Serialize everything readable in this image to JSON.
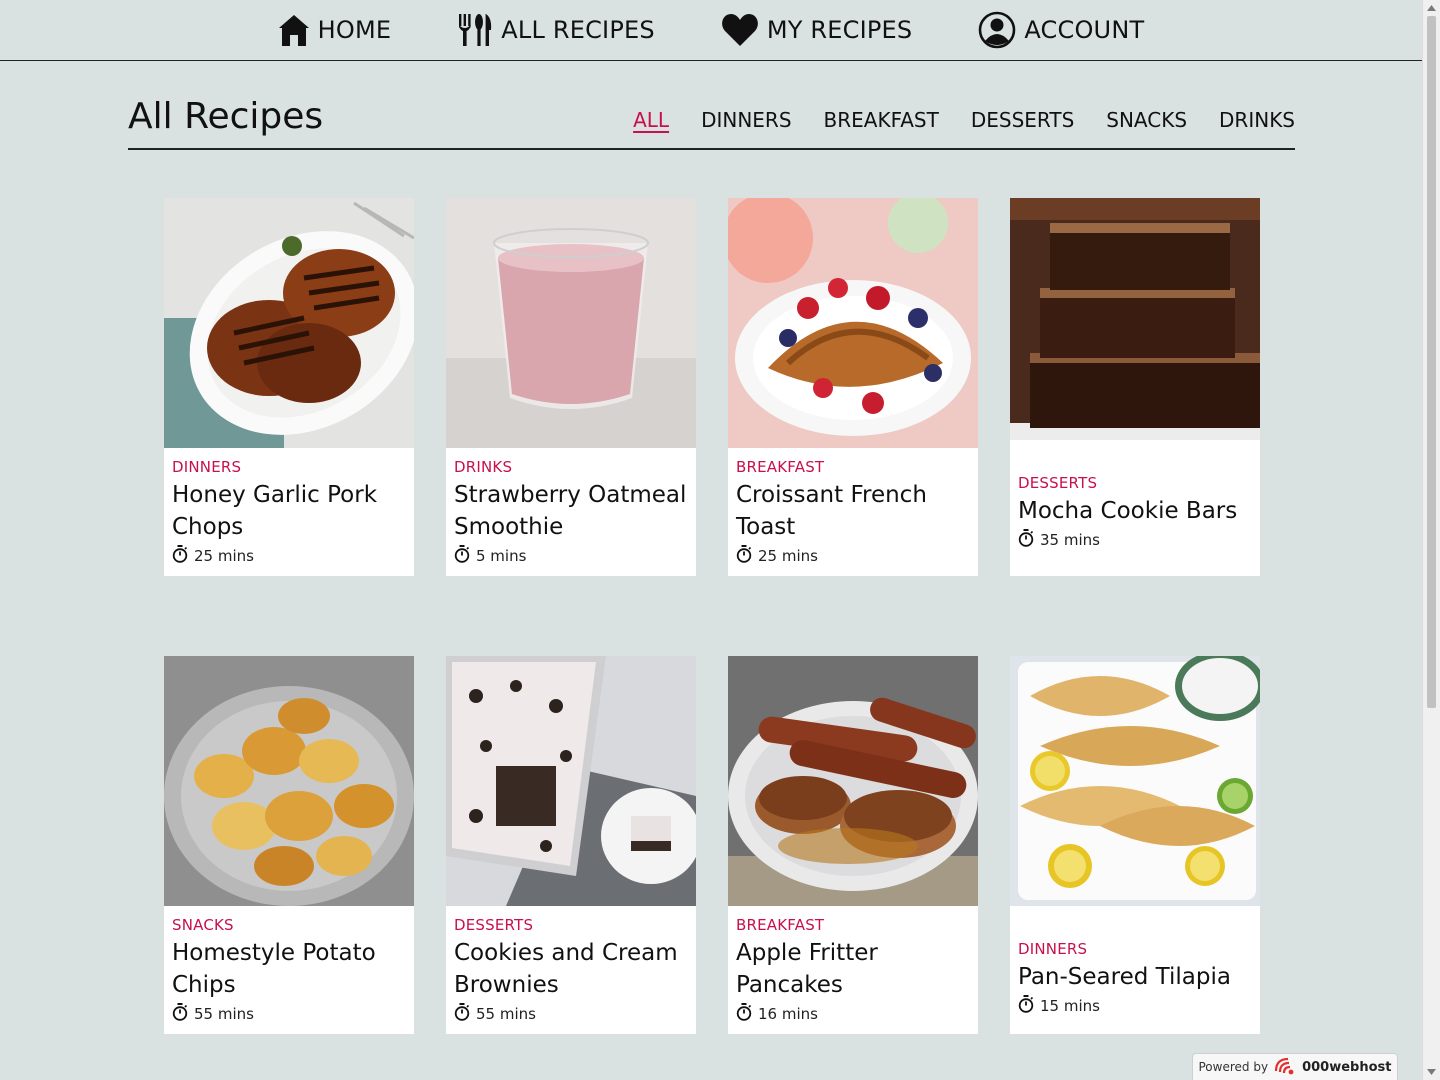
{
  "nav": {
    "items": [
      {
        "label": "HOME",
        "icon": "home-icon"
      },
      {
        "label": "ALL RECIPES",
        "icon": "utensils-icon"
      },
      {
        "label": "MY RECIPES",
        "icon": "heart-icon"
      },
      {
        "label": "ACCOUNT",
        "icon": "user-circle-icon"
      }
    ]
  },
  "page": {
    "title": "All Recipes",
    "filters": [
      "ALL",
      "DINNERS",
      "BREAKFAST",
      "DESSERTS",
      "SNACKS",
      "DRINKS"
    ],
    "active_filter": "ALL"
  },
  "recipes": [
    {
      "category": "DINNERS",
      "title": "Honey Garlic Pork Chops",
      "time": "25 mins",
      "image": "grilled-pork-chops-photo"
    },
    {
      "category": "DRINKS",
      "title": "Strawberry Oatmeal Smoothie",
      "time": "5 mins",
      "image": "pink-smoothie-photo"
    },
    {
      "category": "BREAKFAST",
      "title": "Croissant French Toast",
      "time": "25 mins",
      "image": "croissant-french-toast-photo"
    },
    {
      "category": "DESSERTS",
      "title": "Mocha Cookie Bars",
      "time": "35 mins",
      "image": "mocha-bars-photo"
    },
    {
      "category": "SNACKS",
      "title": "Homestyle Potato Chips",
      "time": "55 mins",
      "image": "potato-chips-photo"
    },
    {
      "category": "DESSERTS",
      "title": "Cookies and Cream Brownies",
      "time": "55 mins",
      "image": "cookies-cream-brownies-photo"
    },
    {
      "category": "BREAKFAST",
      "title": "Apple Fritter Pancakes",
      "time": "16 mins",
      "image": "pancakes-sausages-photo"
    },
    {
      "category": "DINNERS",
      "title": "Pan-Seared Tilapia",
      "time": "15 mins",
      "image": "tilapia-photo"
    }
  ],
  "badge": {
    "prefix": "Powered by",
    "brand": "000webhost"
  },
  "colors": {
    "background": "#d9e2e1",
    "accent": "#c8104b",
    "card": "#ffffff"
  }
}
